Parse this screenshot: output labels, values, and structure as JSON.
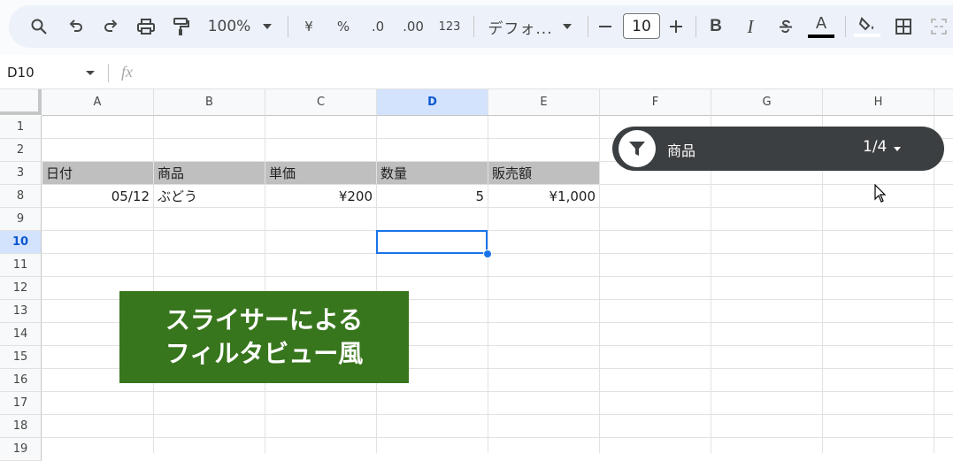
{
  "toolbar": {
    "icons": [
      "search-icon",
      "undo-icon",
      "redo-icon",
      "print-icon",
      "paint-format-icon",
      "zoom-caret-icon",
      "yen-icon",
      "percent-icon",
      "decrease-decimal-icon",
      "increase-decimal-icon",
      "font-caret-icon",
      "minus-icon",
      "plus-icon",
      "bold-icon",
      "italic-icon",
      "strikethrough-icon",
      "text-color-icon",
      "fill-color-icon",
      "borders-icon",
      "merge-icon"
    ],
    "zoom": "100%",
    "currency": "¥",
    "percent": "%",
    "dec_decrease": ".0",
    "dec_increase": ".00",
    "number_format": "123",
    "font": "デフォ...",
    "font_size": "10",
    "bold": "B",
    "italic": "I",
    "text_color": "A",
    "text_color_hex": "#000000"
  },
  "formula_bar": {
    "name_box": "D10",
    "fx": "fx"
  },
  "columns": [
    "A",
    "B",
    "C",
    "D",
    "E",
    "F",
    "G",
    "H"
  ],
  "active_column": "D",
  "rows": [
    "1",
    "2",
    "3",
    "8",
    "9",
    "10",
    "11",
    "12",
    "13",
    "14",
    "15",
    "16",
    "17",
    "18",
    "19"
  ],
  "active_row": "10",
  "table": {
    "headers": [
      "日付",
      "商品",
      "単価",
      "数量",
      "販売額"
    ],
    "row8": [
      "05/12",
      "ぶどう",
      "¥200",
      "5",
      "¥1,000"
    ]
  },
  "slicer": {
    "title": "商品",
    "count": "1/4",
    "bg_color": "#3c3f41"
  },
  "banner": {
    "line1": "スライサーによる",
    "line2": "フィルタビュー風",
    "bg_color": "#38761d"
  },
  "colors": {
    "header_fill": "#bfbfbf",
    "selection": "#1a73e8"
  }
}
